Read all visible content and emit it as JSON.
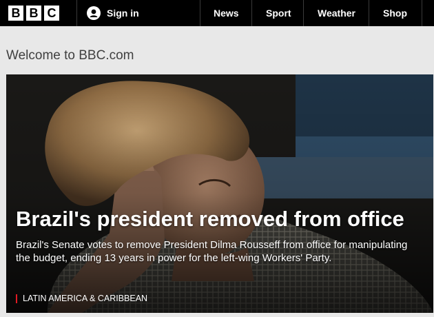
{
  "header": {
    "logo_letters": [
      "B",
      "B",
      "C"
    ],
    "sign_in": {
      "label": "Sign in",
      "icon": "user-icon"
    },
    "nav": [
      {
        "label": "News"
      },
      {
        "label": "Sport"
      },
      {
        "label": "Weather"
      },
      {
        "label": "Shop"
      }
    ]
  },
  "welcome": {
    "title": "Welcome to BBC.com"
  },
  "hero": {
    "headline": "Brazil's president removed from office",
    "summary": "Brazil's Senate votes to remove President Dilma Rousseff from office for manipulating the budget, ending 13 years in power for the left-wing Workers' Party.",
    "tag": "LATIN AMERICA & CARIBBEAN",
    "tag_color": "#e11a23"
  }
}
